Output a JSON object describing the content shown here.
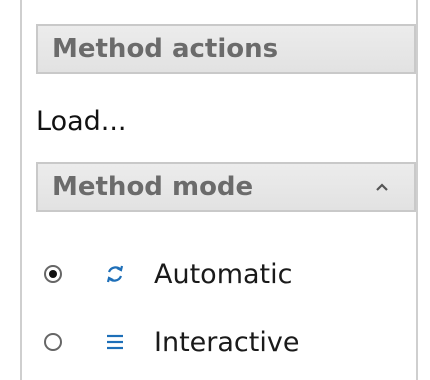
{
  "method_actions": {
    "header": "Method actions",
    "load_label": "Load..."
  },
  "method_mode": {
    "header": "Method mode",
    "collapse_icon": "chevron-up-icon",
    "options": [
      {
        "label": "Automatic",
        "icon": "sync-arrows-icon",
        "selected": true
      },
      {
        "label": "Interactive",
        "icon": "list-lines-icon",
        "selected": false
      }
    ]
  },
  "colors": {
    "header_bg": "#e6e6e6",
    "header_text": "#6b6b6b",
    "icon_blue": "#1e6fb8"
  }
}
